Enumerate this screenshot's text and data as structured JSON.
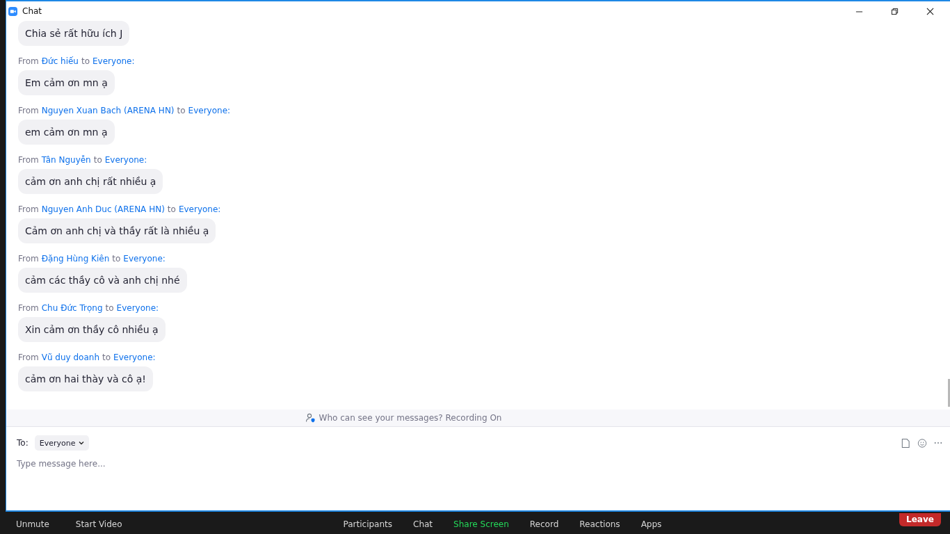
{
  "window": {
    "title": "Chat"
  },
  "messages": [
    {
      "text": "Chia sẻ rất hữu ích J"
    },
    {
      "from_label": "From",
      "sender": "Đức hiếu",
      "to_label": "to",
      "recipient": "Everyone:",
      "text": "Em cảm ơn mn ạ"
    },
    {
      "from_label": "From",
      "sender": "Nguyen Xuan Bach (ARENA HN)",
      "to_label": "to",
      "recipient": "Everyone:",
      "text": "em cảm ơn mn ạ"
    },
    {
      "from_label": "From",
      "sender": "Tân Nguyễn",
      "to_label": "to",
      "recipient": "Everyone:",
      "text": "cảm ơn anh chị rất nhiều ạ"
    },
    {
      "from_label": "From",
      "sender": "Nguyen Anh Duc (ARENA HN)",
      "to_label": "to",
      "recipient": "Everyone:",
      "text": "Cảm ơn anh chị và thầy rất là nhiều ạ"
    },
    {
      "from_label": "From",
      "sender": "Đặng Hùng Kiên",
      "to_label": "to",
      "recipient": "Everyone:",
      "text": "cảm các thầy cô và anh chị nhé"
    },
    {
      "from_label": "From",
      "sender": "Chu Đức Trọng",
      "to_label": "to",
      "recipient": "Everyone:",
      "text": "Xin cảm ơn thầy cô nhiều ạ"
    },
    {
      "from_label": "From",
      "sender": "Vũ duy doanh",
      "to_label": "to",
      "recipient": "Everyone:",
      "text": "cảm ơn hai thày và cô ạ!"
    }
  ],
  "notice": "Who can see your messages? Recording On",
  "composer": {
    "to_label": "To:",
    "recipient": "Everyone",
    "placeholder": "Type message here..."
  },
  "toolbar": [
    {
      "label": "Unmute",
      "kind": "left",
      "color": "#d6d6d6"
    },
    {
      "label": "Start Video",
      "kind": "left",
      "color": "#d6d6d6"
    },
    {
      "label": "Participants",
      "kind": "center",
      "color": "#d6d6d6"
    },
    {
      "label": "Chat",
      "kind": "center",
      "color": "#d6d6d6"
    },
    {
      "label": "Share Screen",
      "kind": "center",
      "color": "#23d959"
    },
    {
      "label": "Record",
      "kind": "center",
      "color": "#d6d6d6"
    },
    {
      "label": "Reactions",
      "kind": "center",
      "color": "#d6d6d6"
    },
    {
      "label": "Apps",
      "kind": "center",
      "color": "#d6d6d6"
    },
    {
      "label": "Leave",
      "kind": "leave"
    }
  ]
}
